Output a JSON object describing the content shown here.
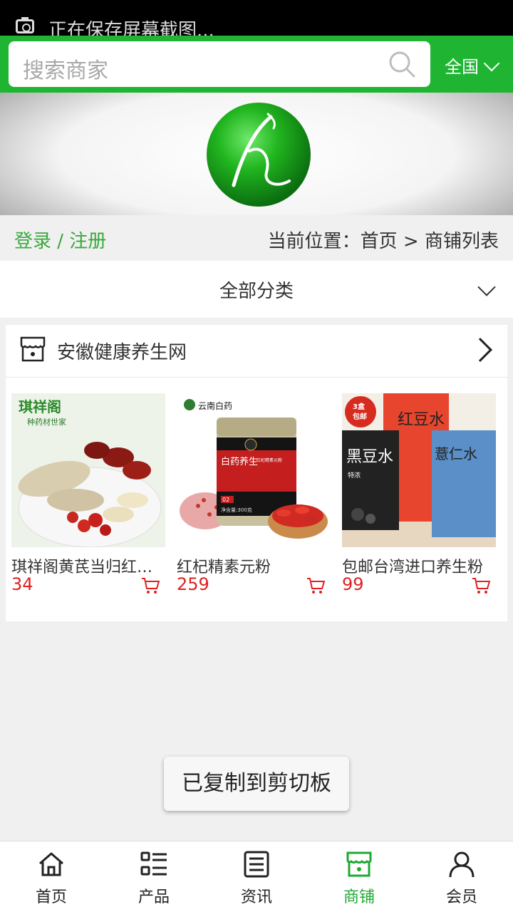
{
  "status_bar": {
    "saving_text": "正在保存屏幕截图..."
  },
  "search": {
    "placeholder": "搜索商家",
    "region": "全国"
  },
  "breadcrumb": {
    "login": "登录 / 注册",
    "location": "当前位置：首页 > 商铺列表"
  },
  "category": {
    "label": "全部分类"
  },
  "shop": {
    "name": "安徽健康养生网",
    "products": [
      {
        "title": "琪祥阁黄芪当归红枣枸杞",
        "price": "34",
        "image_text": [
          "琪祥阁",
          "种药材世家"
        ]
      },
      {
        "title": "红杞精素元粉",
        "price": "259",
        "image_text": [
          "云南白药",
          "白药养生",
          "红杞精素元粉",
          "02",
          "净含量:300克"
        ]
      },
      {
        "title": "包邮台湾进口养生粉",
        "price": "99",
        "image_text": [
          "3盒",
          "包邮",
          "红豆水",
          "黑豆水",
          "薏仁水",
          "特浓"
        ]
      }
    ]
  },
  "toast": {
    "text": "已复制到剪切板"
  },
  "nav": {
    "items": [
      {
        "label": "首页",
        "icon": "home-icon"
      },
      {
        "label": "产品",
        "icon": "list-icon"
      },
      {
        "label": "资讯",
        "icon": "news-icon"
      },
      {
        "label": "商铺",
        "icon": "store-icon"
      },
      {
        "label": "会员",
        "icon": "user-icon"
      }
    ],
    "active": "商铺"
  },
  "colors": {
    "brand_green": "#1fb533",
    "price_red": "#e02020",
    "link_green": "#38a83c"
  }
}
